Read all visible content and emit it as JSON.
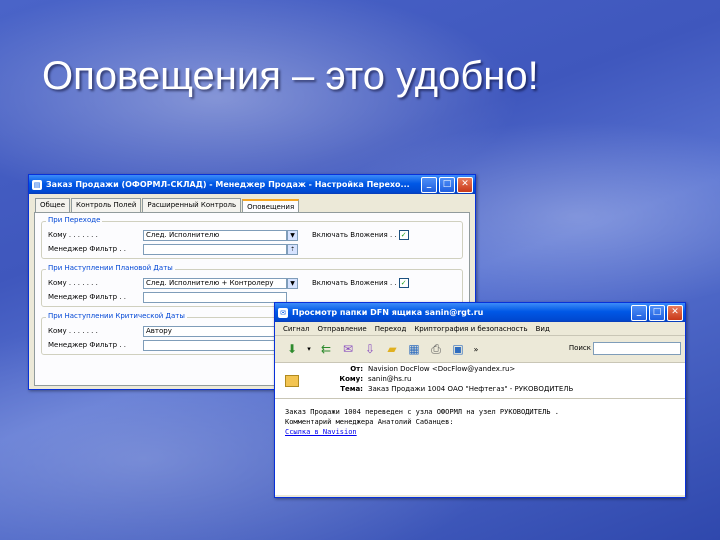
{
  "slide": {
    "title": "Оповещения – это удобно!"
  },
  "window1": {
    "title": "Заказ Продажи (ОФОРМЛ-СКЛАД) - Менеджер Продаж - Настройка Перехо...",
    "buttons": {
      "minimize": "_",
      "maximize": "□",
      "close": "✕"
    },
    "tabs": [
      "Общее",
      "Контроль Полей",
      "Расширенный Контроль",
      "Оповещения"
    ],
    "active_tab": "Оповещения",
    "groups": [
      {
        "label": "При Переходе",
        "rows": [
          {
            "label": "Кому . . . . . . .",
            "value": "След. Исполнителю",
            "check_label": "Включать Вложения . .",
            "checked": true
          },
          {
            "label": "Менеджер Фильтр . .",
            "value": ""
          }
        ]
      },
      {
        "label": "При Наступлении Плановой Даты",
        "rows": [
          {
            "label": "Кому . . . . . . .",
            "value": "След. Исполнителю + Контролеру",
            "check_label": "Включать Вложения . .",
            "checked": true
          },
          {
            "label": "Менеджер Фильтр . .",
            "value": ""
          }
        ]
      },
      {
        "label": "При Наступлении Критической Даты",
        "rows": [
          {
            "label": "Кому . . . . . . .",
            "value": "Автору"
          },
          {
            "label": "Менеджер Фильтр . .",
            "value": ""
          }
        ]
      }
    ]
  },
  "window2": {
    "title": "Просмотр папки DFN ящика sanin@rgt.ru",
    "buttons": {
      "minimize": "_",
      "maximize": "□",
      "close": "✕"
    },
    "menu": [
      "Сигнал",
      "Отправление",
      "Переход",
      "Криптография и безопасность",
      "Вид"
    ],
    "toolbar_chevron": "»",
    "search_label": "Поиск",
    "header": {
      "from_label": "От:",
      "from_value": "Navision DocFlow <DocFlow@yandex.ru>",
      "to_label": "Кому:",
      "to_value": "sanin@hs.ru",
      "subject_label": "Тема:",
      "subject_value": "Заказ Продажи 1004 ОАО \"Нефтегаз\" - РУКОВОДИТЕЛЬ"
    },
    "body": {
      "line1": "Заказ Продажи 1004 переведен с узла ОФОРМЛ на узел РУКОВОДИТЕЛЬ .",
      "line2": "Комментарий менеджера Анатолий Сабанцев:",
      "link": "Ссылка в Navision"
    }
  },
  "colors": {
    "xp_title": "#0058e6",
    "slide_bg": "#4a64c8",
    "link": "#0000ee"
  }
}
